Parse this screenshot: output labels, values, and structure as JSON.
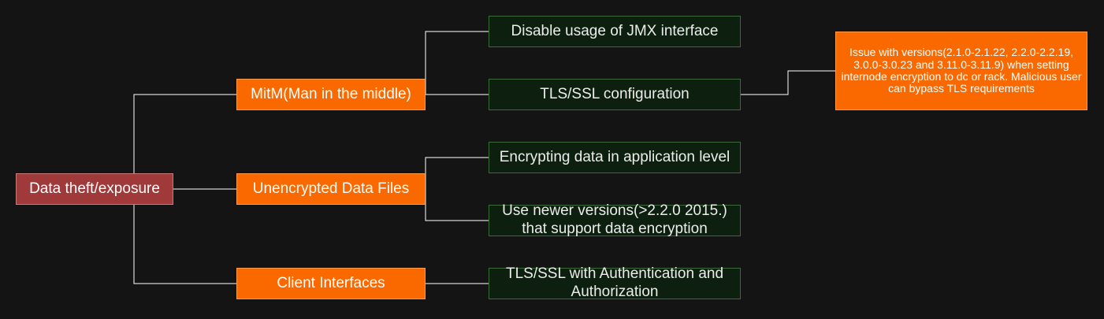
{
  "diagram": {
    "root": {
      "label": "Data theft/exposure"
    },
    "categories": [
      {
        "label": "MitM(Man in the middle)"
      },
      {
        "label": "Unencrypted Data Files"
      },
      {
        "label": "Client Interfaces"
      }
    ],
    "leaves": [
      {
        "label": "Disable usage of JMX interface"
      },
      {
        "label": "TLS/SSL configuration"
      },
      {
        "label": "Encrypting data in application level"
      },
      {
        "label": "Use newer versions(>2.2.0 2015.) that support data encryption"
      },
      {
        "label": "TLS/SSL with Authentication and Authorization"
      }
    ],
    "note": {
      "label": "Issue with versions(2.1.0-2.1.22, 2.2.0-2.2.19, 3.0.0-3.0.23 and 3.11.0-3.11.9) when setting internode encryption to dc or rack. Malicious user can bypass TLS requirements"
    },
    "colors": {
      "background": "#141414",
      "root_fill": "#a03a3a",
      "category_fill": "#fa6800",
      "leaf_fill": "#0d200f",
      "leaf_stroke": "#3a6b38",
      "edge": "#ffffff"
    }
  }
}
